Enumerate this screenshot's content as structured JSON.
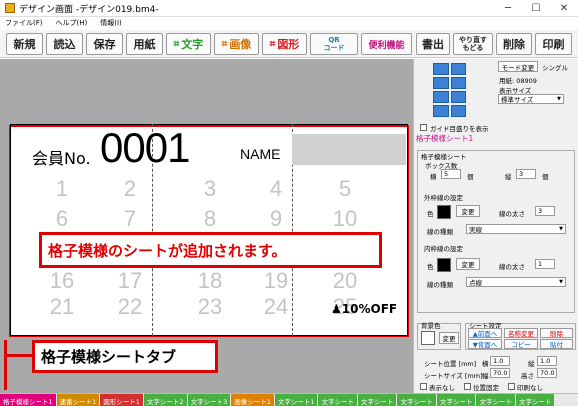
{
  "window": {
    "title": "デザイン画面 -デザイン019.bm4-"
  },
  "menu": [
    "ファイル(F)",
    "ヘルプ(H)",
    "情報(I)"
  ],
  "toolbar": {
    "new": "新規",
    "open": "読込",
    "save": "保存",
    "paper": "用紙",
    "text": "文字",
    "image": "画像",
    "shape": "図形",
    "qr": "QR\nコード",
    "convenience": "便利機能",
    "print_out": "書出",
    "redo_top": "やり直す",
    "redo_bottom": "もどる",
    "delete": "削除",
    "print": "印刷"
  },
  "canvas": {
    "member_label": "会員No.",
    "member_number": "0001",
    "name_label": "NAME",
    "grid_numbers": [
      "1",
      "2",
      "3",
      "4",
      "5",
      "6",
      "7",
      "8",
      "9",
      "10",
      "16",
      "17",
      "18",
      "19",
      "20",
      "21",
      "22",
      "23",
      "24",
      "25"
    ],
    "discount": "10%OFF",
    "callout_main": "格子模様のシートが追加されます。",
    "callout_tab": "格子模様シートタブ"
  },
  "right_panel": {
    "mode_change": "モード変更",
    "single": "シングル",
    "paper_label": "用紙: 08909",
    "display_size_label": "表示サイズ",
    "display_size_value": "標準サイズ",
    "guide_label": "ガイド目盛りを表示",
    "section_title": "格子模様シート1",
    "grid_sheet_group": "格子模様シート",
    "box_count_label": "ボックス数",
    "horizontal_label": "横",
    "horizontal_value": "5",
    "horizontal_unit": "個",
    "vertical_label": "縦",
    "vertical_value": "3",
    "vertical_unit": "個",
    "outer_group": "外枠線の設定",
    "color_label": "色",
    "change_btn": "変更",
    "line_width_label": "線の太さ",
    "outer_width_value": "3",
    "line_type_label": "線の種類",
    "outer_type_value": "実線",
    "inner_group": "内枠線の設定",
    "inner_width_value": "1",
    "inner_type_value": "点線",
    "bg_group": "背景色",
    "sheet_setting_group": "シート設定",
    "front_btn": "▲前面へ",
    "back_btn": "▼背面へ",
    "rename_btn": "名称変更",
    "copy_btn": "コピー",
    "delete_btn": "削除",
    "paste_btn": "貼付",
    "pos_label": "シート位置 [mm]",
    "pos_x_label": "横",
    "pos_x_value": "1.0",
    "pos_y_label": "縦",
    "pos_y_value": "1.0",
    "size_label": "シートサイズ [mm]",
    "width_label": "幅",
    "width_value": "70.0",
    "height_label": "高さ",
    "height_value": "70.0",
    "hide_label": "表示なし",
    "fix_pos_label": "位置固定",
    "no_print_label": "印刷なし"
  },
  "tabs": [
    {
      "label": "格子模様シート1",
      "color": "#e0007a"
    },
    {
      "label": "連番シート1",
      "color": "#d08a00"
    },
    {
      "label": "図形シート1",
      "color": "#d03030"
    },
    {
      "label": "文字シート2",
      "color": "#48b040"
    },
    {
      "label": "文字シート3",
      "color": "#48b040"
    },
    {
      "label": "画像シート1",
      "color": "#e08000"
    },
    {
      "label": "文字シート1",
      "color": "#48b040"
    },
    {
      "label": "文字シート",
      "color": "#48b040"
    },
    {
      "label": "文字シート",
      "color": "#48b040"
    },
    {
      "label": "文字シート",
      "color": "#48b040"
    },
    {
      "label": "文字シート",
      "color": "#48b040"
    },
    {
      "label": "文字シート",
      "color": "#48b040"
    },
    {
      "label": "文字シート",
      "color": "#48b040"
    }
  ],
  "colors": {
    "accent": "#e00000",
    "grid_icon": "#3b82d6",
    "section_title": "#c8108a"
  }
}
